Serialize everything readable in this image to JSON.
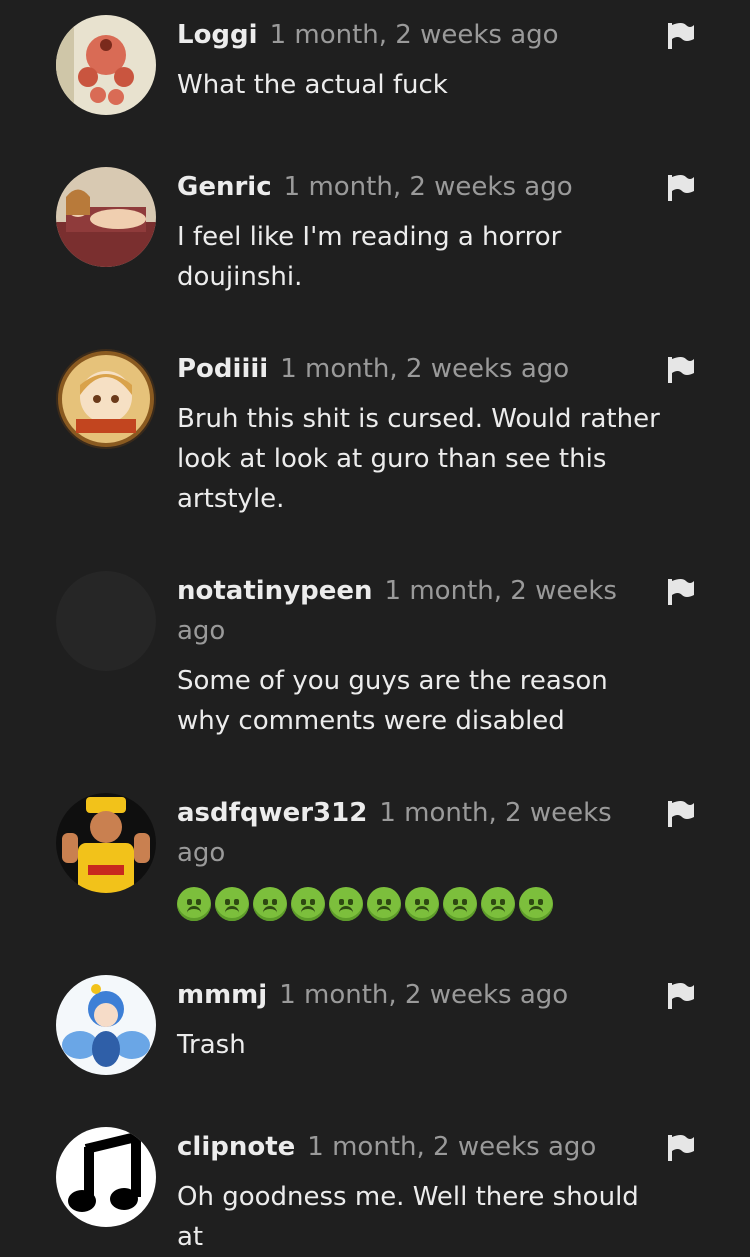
{
  "comments": [
    {
      "username": "Loggi",
      "time": "1 month, 2 weeks ago",
      "text": "What the actual fuck",
      "avatar": "avatar-illustration-red-creature"
    },
    {
      "username": "Genric",
      "time": "1 month, 2 weeks ago",
      "text": "I feel like I'm reading a horror doujinshi.",
      "avatar": "avatar-illustration-couch-character"
    },
    {
      "username": "Podiiii",
      "time": "1 month, 2 weeks ago",
      "text": "Bruh this shit is cursed. Would rather look at look at guro than see this artstyle.",
      "avatar": "avatar-illustration-anime-badge"
    },
    {
      "username": "notatinypeen",
      "time": "1 month, 2 weeks ago",
      "text": "Some of you guys are the reason why comments were disabled",
      "avatar": "avatar-empty"
    },
    {
      "username": "asdfqwer312",
      "time": "1 month, 2 weeks ago",
      "text": "",
      "emoji_name": "nauseated-face-emoji",
      "emoji_count": 10,
      "avatar": "avatar-photo-wrestler"
    },
    {
      "username": "mmmj",
      "time": "1 month, 2 weeks ago",
      "text": "Trash",
      "avatar": "avatar-illustration-blue-hair"
    },
    {
      "username": "clipnote",
      "time": "1 month, 2 weeks ago",
      "text": "Oh goodness me. Well there should at",
      "avatar": "avatar-music-note"
    }
  ],
  "flag_icon": "flag-icon",
  "colors": {
    "background": "#1f1f1f",
    "username": "#ececec",
    "time": "#9a9a9a",
    "text": "#ececec",
    "emoji": "#7cbf3c"
  }
}
